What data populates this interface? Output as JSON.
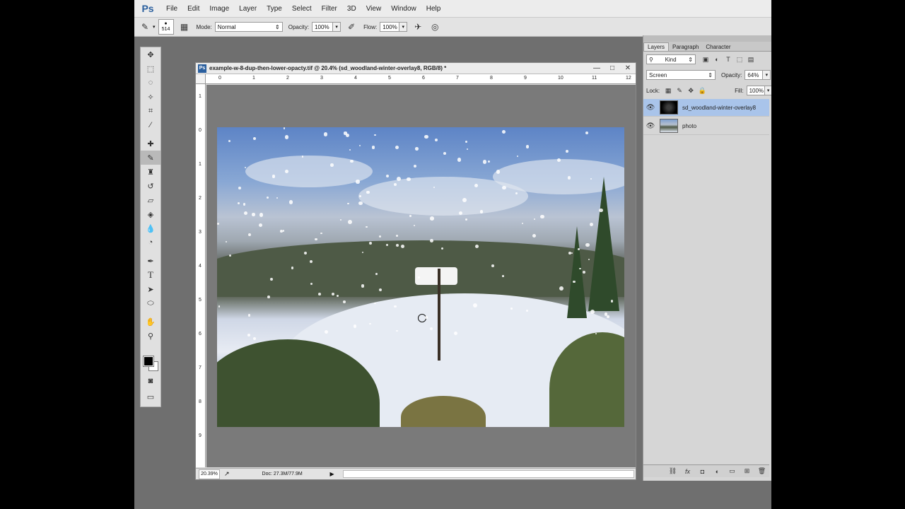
{
  "menubar": {
    "logo": "Ps",
    "items": [
      "File",
      "Edit",
      "Image",
      "Layer",
      "Type",
      "Select",
      "Filter",
      "3D",
      "View",
      "Window",
      "Help"
    ]
  },
  "options": {
    "brush_size": "514",
    "mode_label": "Mode:",
    "mode_value": "Normal",
    "opacity_label": "Opacity:",
    "opacity_value": "100%",
    "flow_label": "Flow:",
    "flow_value": "100%"
  },
  "document": {
    "title": "example-w-8-dup-then-lower-opacty.tif @ 20.4% (sd_woodland-winter-overlay8, RGB/8) *",
    "zoom": "20.39%",
    "doc_info": "Doc: 27.3M/77.9M",
    "ruler_h": [
      "0",
      "1",
      "2",
      "3",
      "4",
      "5",
      "6",
      "7",
      "8",
      "9",
      "10",
      "11",
      "12"
    ],
    "ruler_v": [
      "1",
      "0",
      "1",
      "2",
      "3",
      "4",
      "5",
      "6",
      "7",
      "8",
      "9"
    ]
  },
  "layers_panel": {
    "tabs": [
      "Layers",
      "Paragraph",
      "Character"
    ],
    "kind_label": "Kind",
    "blend_mode": "Screen",
    "opacity_label": "Opacity:",
    "opacity_value": "64%",
    "lock_label": "Lock:",
    "fill_label": "Fill:",
    "fill_value": "100%",
    "layers": [
      {
        "name": "sd_woodland-winter-overlay8",
        "selected": true
      },
      {
        "name": "photo",
        "selected": false
      }
    ]
  },
  "colors": {
    "accent": "#a9c4ea",
    "brand": "#2a5f9e"
  }
}
